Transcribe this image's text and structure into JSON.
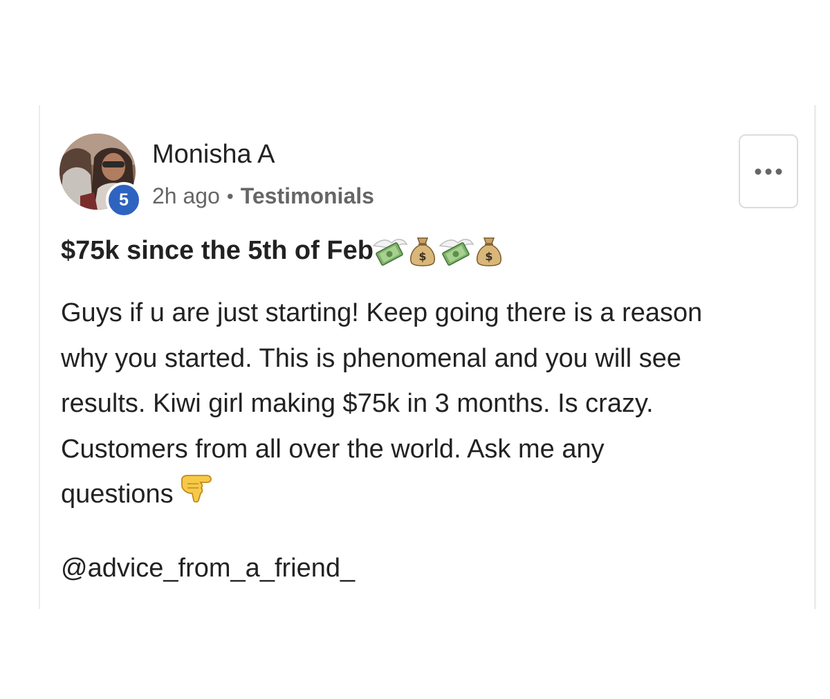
{
  "post": {
    "author": {
      "name": "Monisha A",
      "level": "5",
      "avatar": "profile-photo"
    },
    "meta": {
      "time": "2h ago",
      "separator": "•",
      "category": "Testimonials"
    },
    "more_button_icon": "more-horizontal-icon",
    "title": "$75k since the 5th of Feb",
    "title_emojis": [
      "money-with-wings-icon",
      "money-bag-icon",
      "money-with-wings-icon",
      "money-bag-icon"
    ],
    "body_lines": [
      "Guys if u are just starting! Keep going there is a reason",
      "why you started. This is phenomenal and you will see",
      "results. Kiwi girl making $75k in 3 months. Is crazy.",
      "Customers from all over the world. Ask me any",
      "questions"
    ],
    "body_end_emoji": "backhand-index-pointing-right-icon",
    "mention": "@advice_from_a_friend_"
  },
  "colors": {
    "badge": "#2f63c0",
    "text": "#222222",
    "meta": "#666666",
    "border": "#dcdcdc"
  }
}
